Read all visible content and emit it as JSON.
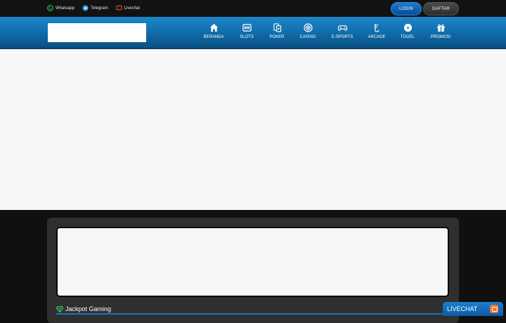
{
  "topbar": {
    "contacts": [
      {
        "label": "Whatsapp",
        "icon": "whatsapp-icon",
        "color": "#25d366"
      },
      {
        "label": "Telegram",
        "icon": "telegram-icon",
        "color": "#2aa3df"
      },
      {
        "label": "Livechat",
        "icon": "livechat-icon",
        "color": "#e9522e"
      }
    ],
    "login_label": "LOGIN",
    "daftar_label": "DAFTAR"
  },
  "nav": {
    "items": [
      {
        "label": "BERANDA",
        "icon": "home-icon"
      },
      {
        "label": "SLOTS",
        "icon": "slot-machine-icon"
      },
      {
        "label": "POKER",
        "icon": "cards-icon"
      },
      {
        "label": "CASINO",
        "icon": "roulette-icon"
      },
      {
        "label": "E-SPORTS",
        "icon": "gamepad-icon"
      },
      {
        "label": "ARCADE",
        "icon": "fishing-icon"
      },
      {
        "label": "TOGEL",
        "icon": "lottery-ball-icon"
      },
      {
        "label": "PROMOSI",
        "icon": "gift-icon"
      }
    ]
  },
  "jackpot": {
    "title": "Jackpot Gaming"
  },
  "livechat": {
    "label": "LIVECHAT"
  },
  "colors": {
    "accent": "#1b87c9",
    "login_button": "#1b7bd0",
    "daftar_button": "#3a3a3a",
    "jackpot_icon": "#2ecc71",
    "livechat_icon": "#e9772e"
  }
}
